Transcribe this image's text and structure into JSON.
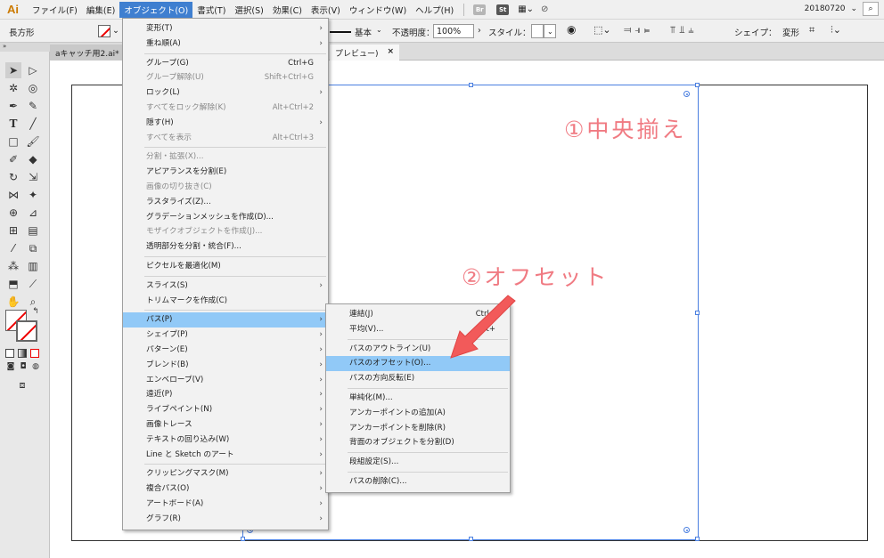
{
  "menubar": {
    "logo": "Ai",
    "items": [
      "ファイル(F)",
      "編集(E)",
      "オブジェクト(O)",
      "書式(T)",
      "選択(S)",
      "効果(C)",
      "表示(V)",
      "ウィンドウ(W)",
      "ヘルプ(H)"
    ],
    "active_index": 2,
    "bridge_icon": "Br",
    "stock_icon": "St",
    "workspace_version": "20180720",
    "accent_color": "#3f7fd0"
  },
  "control_bar": {
    "tool_name": "長方形",
    "stroke_profile": "基本",
    "opacity_label": "不透明度：",
    "opacity_value": "100%",
    "style_label": "スタイル：",
    "shape_label": "シェイプ：",
    "transform_label": "変形"
  },
  "tabs": {
    "doc1": "aキャッチ用2.ai* @",
    "doc2": "プレビュー)",
    "close": "×"
  },
  "annotations": {
    "step1": "①中央揃え",
    "step2": "②オフセット",
    "color": "#f07a82"
  },
  "object_menu": {
    "items": [
      {
        "label": "変形(T)",
        "sub": true
      },
      {
        "label": "重ね順(A)",
        "sub": true
      },
      {
        "sep": true
      },
      {
        "label": "グループ(G)",
        "shortcut": "Ctrl+G"
      },
      {
        "label": "グループ解除(U)",
        "shortcut": "Shift+Ctrl+G",
        "disabled": true
      },
      {
        "label": "ロック(L)",
        "sub": true
      },
      {
        "label": "すべてをロック解除(K)",
        "shortcut": "Alt+Ctrl+2",
        "disabled": true
      },
      {
        "label": "隠す(H)",
        "sub": true
      },
      {
        "label": "すべてを表示",
        "shortcut": "Alt+Ctrl+3",
        "disabled": true
      },
      {
        "sep": true
      },
      {
        "label": "分割・拡張(X)...",
        "disabled": true
      },
      {
        "label": "アピアランスを分割(E)"
      },
      {
        "label": "画像の切り抜き(C)",
        "disabled": true
      },
      {
        "label": "ラスタライズ(Z)..."
      },
      {
        "label": "グラデーションメッシュを作成(D)..."
      },
      {
        "label": "モザイクオブジェクトを作成(J)...",
        "disabled": true
      },
      {
        "label": "透明部分を分割・統合(F)..."
      },
      {
        "sep": true
      },
      {
        "label": "ピクセルを最適化(M)"
      },
      {
        "sep": true
      },
      {
        "label": "スライス(S)",
        "sub": true
      },
      {
        "label": "トリムマークを作成(C)"
      },
      {
        "sep": true
      },
      {
        "label": "パス(P)",
        "sub": true,
        "highlight": true
      },
      {
        "label": "シェイプ(P)",
        "sub": true
      },
      {
        "label": "パターン(E)",
        "sub": true
      },
      {
        "label": "ブレンド(B)",
        "sub": true
      },
      {
        "label": "エンベロープ(V)",
        "sub": true
      },
      {
        "label": "遠近(P)",
        "sub": true
      },
      {
        "label": "ライブペイント(N)",
        "sub": true
      },
      {
        "label": "画像トレース",
        "sub": true
      },
      {
        "label": "テキストの回り込み(W)",
        "sub": true
      },
      {
        "label": "Line と Sketch のアート",
        "sub": true
      },
      {
        "sep": true
      },
      {
        "label": "クリッピングマスク(M)",
        "sub": true
      },
      {
        "label": "複合パス(O)",
        "sub": true
      },
      {
        "label": "アートボード(A)",
        "sub": true
      },
      {
        "label": "グラフ(R)",
        "sub": true
      }
    ]
  },
  "path_menu": {
    "items": [
      {
        "label": "連結(J)",
        "shortcut": "Ctrl+"
      },
      {
        "label": "平均(V)...",
        "shortcut": "Alt+"
      },
      {
        "sep": true
      },
      {
        "label": "パスのアウトライン(U)"
      },
      {
        "label": "パスのオフセット(O)...",
        "highlight": true
      },
      {
        "label": "パスの方向反転(E)"
      },
      {
        "sep": true
      },
      {
        "label": "単純化(M)..."
      },
      {
        "label": "アンカーポイントの追加(A)"
      },
      {
        "label": "アンカーポイントを削除(R)"
      },
      {
        "label": "背面のオブジェクトを分割(D)"
      },
      {
        "sep": true
      },
      {
        "label": "段組設定(S)..."
      },
      {
        "sep": true
      },
      {
        "label": "パスの削除(C)..."
      }
    ]
  }
}
